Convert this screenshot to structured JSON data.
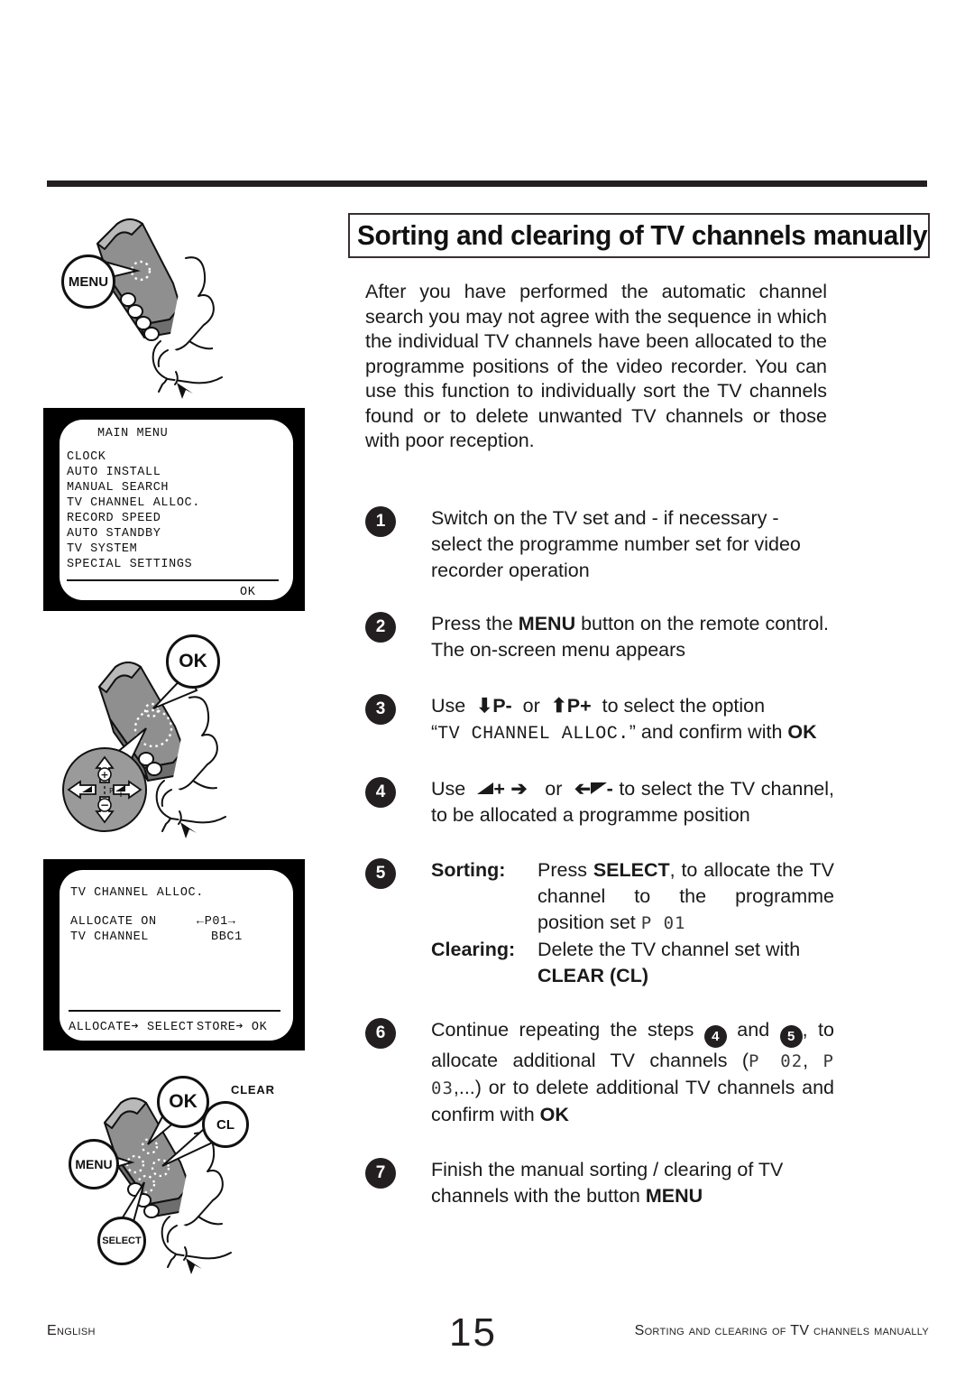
{
  "page": {
    "title": "Sorting and clearing of TV channels manually",
    "intro": "After you have performed the automatic channel search you may not agree with the sequence in which the individual TV channels have been allocated to the programme positions of the video recorder. You can use this function to individually sort the TV channels found or to delete unwanted TV channels or those with poor reception."
  },
  "steps": [
    {
      "number": "1",
      "text": "Switch on the TV set and - if necessary -  select the programme number  set for video recorder operation"
    },
    {
      "number": "2",
      "pre": "Press the ",
      "bold1": "MENU",
      "post": " button on the remote control. The on-screen menu appears"
    },
    {
      "number": "3",
      "use": "Use",
      "key_down": "P-",
      "or": "or",
      "key_up": "P+",
      "mid": "to select the option",
      "quote_open": "“",
      "option": "TV CHANNEL ALLOC.",
      "quote_close": "”",
      "tail": " and confirm with ",
      "confirm": "OK"
    },
    {
      "number": "4",
      "use": "Use",
      "vol_up_label": "+",
      "arrow_right": "➔",
      "or": "or",
      "arrow_left": "➔",
      "vol_down_label": "-",
      "tail": "to select the TV channel, to be allocated a programme position"
    },
    {
      "number": "5",
      "sorting_label": "Sorting:",
      "sorting_pre": "Press ",
      "sorting_key": "SELECT",
      "sorting_mid": ", to allocate the TV channel to the programme position set ",
      "sorting_lcd": "P 01",
      "clearing_label": "Clearing:",
      "clearing_text": "Delete the TV channel set with ",
      "clearing_key": "CLEAR (CL)"
    },
    {
      "number": "6",
      "pre": "Continue repeating the steps ",
      "ref1": "4",
      "mid1": " and ",
      "ref2": "5",
      "mid2": ", to allocate additional TV channels (",
      "lcd1": "P 02",
      "comma": ", ",
      "lcd2": "P 03",
      "mid3": ",...) or to delete additional TV channels and confirm with ",
      "confirm": "OK"
    },
    {
      "number": "7",
      "pre": "Finish the manual sorting / clearing of TV channels with the button ",
      "key": "MENU"
    }
  ],
  "tv_screens": [
    {
      "id": "main-menu",
      "heading": "MAIN MENU",
      "items": [
        "CLOCK",
        "AUTO INSTALL",
        "MANUAL SEARCH",
        "TV CHANNEL ALLOC.",
        "RECORD SPEED",
        "AUTO STANDBY",
        "TV SYSTEM",
        "SPECIAL SETTINGS"
      ],
      "footer_right": "OK"
    },
    {
      "id": "tv-channel-alloc",
      "heading": "TV CHANNEL ALLOC.",
      "rows": [
        {
          "label": "ALLOCATE ON",
          "value": "←P01→"
        },
        {
          "label": "TV CHANNEL",
          "value": "BBC1"
        }
      ],
      "footer_left": "ALLOCATE➔ SELECT",
      "footer_right": "STORE➔ OK"
    }
  ],
  "illustrations": [
    {
      "id": "remote-menu",
      "callouts": [
        {
          "label": "MENU"
        }
      ]
    },
    {
      "id": "remote-ok-dpad",
      "callouts": [
        {
          "label": "OK"
        }
      ],
      "dpad": {
        "up": "+",
        "down": "−",
        "left": "−",
        "right": "+",
        "center": "P"
      }
    },
    {
      "id": "remote-buttons",
      "callouts": [
        {
          "label": "OK"
        },
        {
          "label": "CL"
        },
        {
          "label": "MENU"
        },
        {
          "label": "SELECT"
        }
      ],
      "clear_label": "CLEAR"
    }
  ],
  "footer": {
    "left": "English",
    "page": "15",
    "right": "Sorting and clearing of TV channels manually"
  },
  "colors": {
    "ink": "#231f20",
    "remote_body": "#8a8a8a",
    "remote_light": "#b5b5b5",
    "remote_dark": "#6b6b6b"
  }
}
